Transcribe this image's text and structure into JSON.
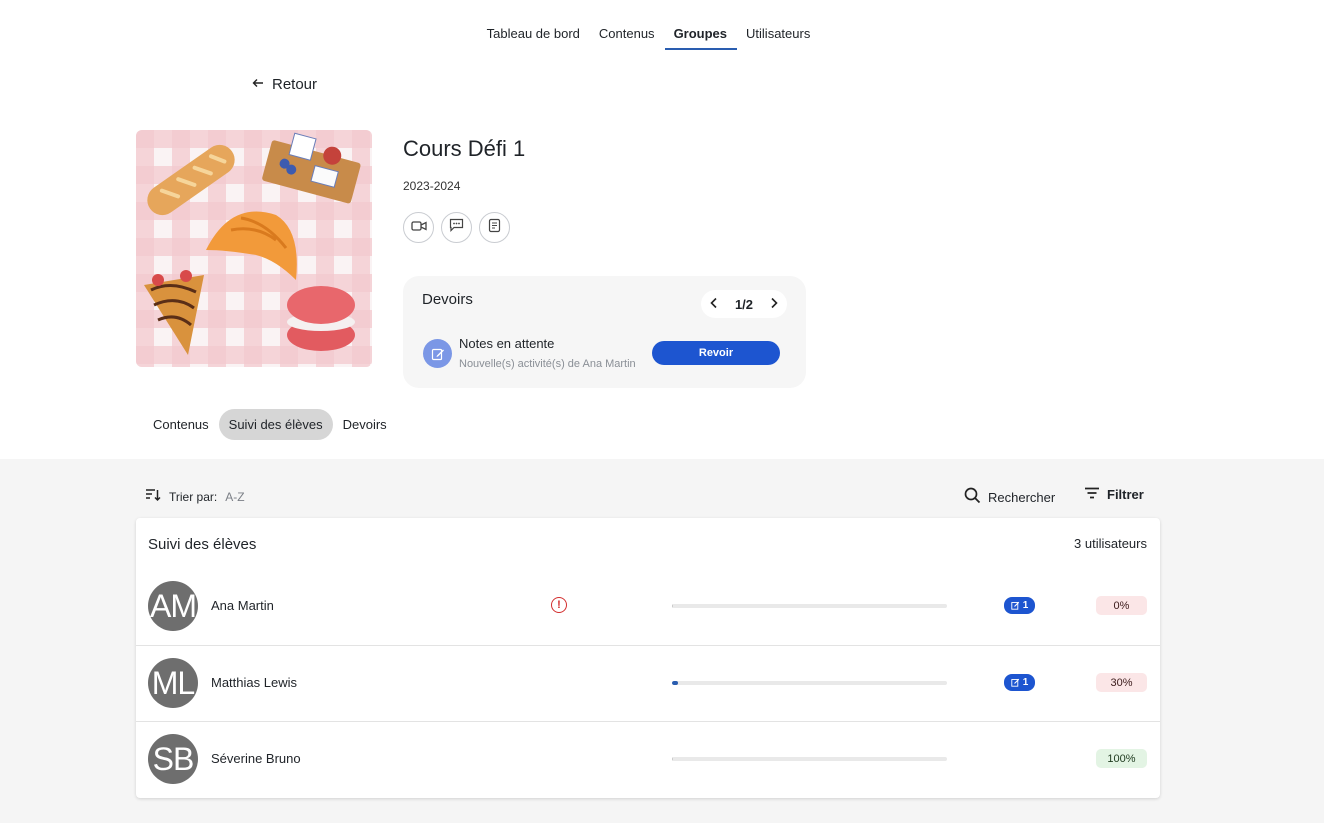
{
  "nav": {
    "items": [
      {
        "label": "Tableau de bord",
        "active": false
      },
      {
        "label": "Contenus",
        "active": false
      },
      {
        "label": "Groupes",
        "active": true
      },
      {
        "label": "Utilisateurs",
        "active": false
      }
    ]
  },
  "back": {
    "label": "Retour"
  },
  "group": {
    "title": "Cours Défi 1",
    "year": "2023-2024",
    "actions": [
      {
        "icon": "video-icon"
      },
      {
        "icon": "chat-icon"
      },
      {
        "icon": "document-icon"
      }
    ]
  },
  "devoirs": {
    "title": "Devoirs",
    "pager": "1/2",
    "pending_title": "Notes en attente",
    "pending_subtitle": "Nouvelle(s) activité(s) de Ana Martin",
    "review_button": "Revoir"
  },
  "subtabs": [
    {
      "label": "Contenus",
      "active": false
    },
    {
      "label": "Suivi des élèves",
      "active": true
    },
    {
      "label": "Devoirs",
      "active": false
    }
  ],
  "toolbar": {
    "sort_label": "Trier par:",
    "sort_value": "A-Z",
    "search_label": "Rechercher",
    "filter_label": "Filtrer"
  },
  "table": {
    "title": "Suivi des élèves",
    "count": "3 utilisateurs",
    "rows": [
      {
        "initials": "AM",
        "name": "Ana Martin",
        "warning": true,
        "progress": 0,
        "pending_count": "1",
        "percent": "0%",
        "status": "low"
      },
      {
        "initials": "ML",
        "name": "Matthias Lewis",
        "warning": false,
        "progress": 0.02,
        "pending_count": "1",
        "percent": "30%",
        "status": "low"
      },
      {
        "initials": "SB",
        "name": "Séverine Bruno",
        "warning": false,
        "progress": 0,
        "pending_count": "",
        "percent": "100%",
        "status": "full"
      }
    ]
  },
  "colors": {
    "accent": "#1d55d0",
    "nav_underline": "#2a5db0",
    "avatar_bg": "#6e6e6e",
    "warning": "#d32f2f",
    "pct_low_bg": "#fbe6e7",
    "pct_full_bg": "#e3f4e4"
  }
}
